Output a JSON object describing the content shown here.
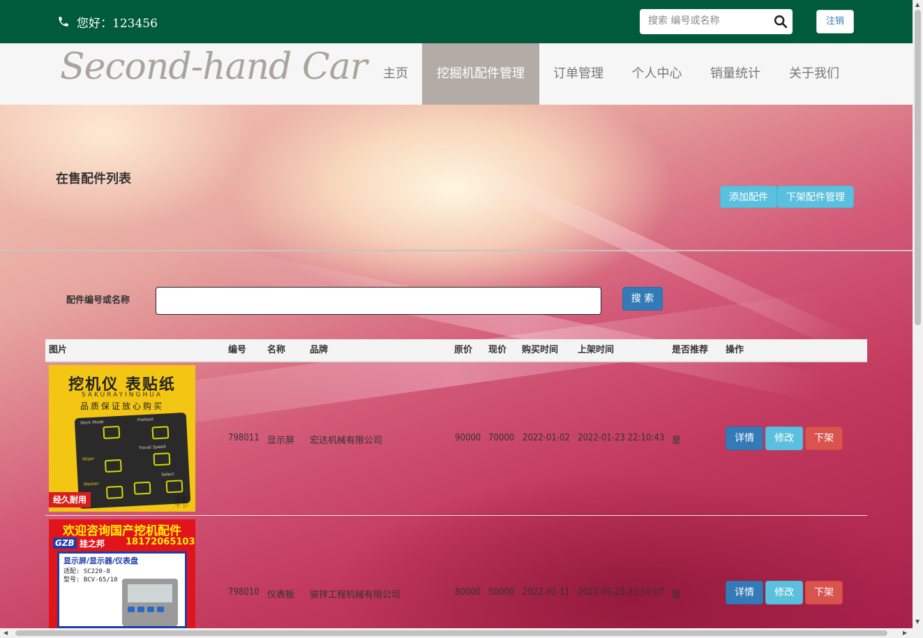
{
  "header": {
    "greeting": "您好：123456",
    "search_placeholder": "搜索 编号或名称",
    "logout_label": "注销",
    "brand_color": "#005a3c"
  },
  "nav": {
    "logo": "Second-hand Car",
    "items": [
      "主页",
      "挖掘机配件管理",
      "订单管理",
      "个人中心",
      "销量统计",
      "关于我们"
    ],
    "active_index": 1
  },
  "page": {
    "title": "在售配件列表",
    "add_button": "添加配件",
    "offshelf_manage_button": "下架配件管理",
    "filter_label": "配件编号或名称",
    "filter_value": "",
    "search_button": "搜 索"
  },
  "table": {
    "headers": [
      "图片",
      "编号",
      "名称",
      "品牌",
      "原价",
      "现价",
      "购买时间",
      "上架时间",
      "是否推荐",
      "操作"
    ],
    "rows": [
      {
        "id": "798011",
        "name": "显示屏",
        "brand": "宏达机械有限公司",
        "original_price": "90000",
        "current_price": "70000",
        "purchase_date": "2022-01-02",
        "listed_time": "2022-01-23 22:10:43",
        "recommended": "是",
        "image": {
          "title": "挖机仪 表贴纸",
          "sub": "SAKURAYINGHUA",
          "slogan": "品质保证放心购买",
          "badge": "经久耐用",
          "watermark": "韩",
          "panel_labels": [
            "Work Mode",
            "Preheat",
            "Travel Speed",
            "Wiper",
            "Washer",
            "Select"
          ]
        }
      },
      {
        "id": "798010",
        "name": "仪表板",
        "brand": "骏祥工程机械有限公司",
        "original_price": "80000",
        "current_price": "50000",
        "purchase_date": "2022-01-11",
        "listed_time": "2022-01-23 22:10:07",
        "recommended": "是",
        "image": {
          "title": "欢迎咨询国产挖机配件",
          "logo": "GZB",
          "logo_text": "挂之邦",
          "phone": "18172065103",
          "line1": "显示屏/显示器/仪表盘",
          "line2": "适配: SC220-8",
          "line3": "型号: BCV-65/10"
        }
      }
    ],
    "actions": {
      "detail": "详情",
      "edit": "修改",
      "offshelf": "下架"
    }
  }
}
